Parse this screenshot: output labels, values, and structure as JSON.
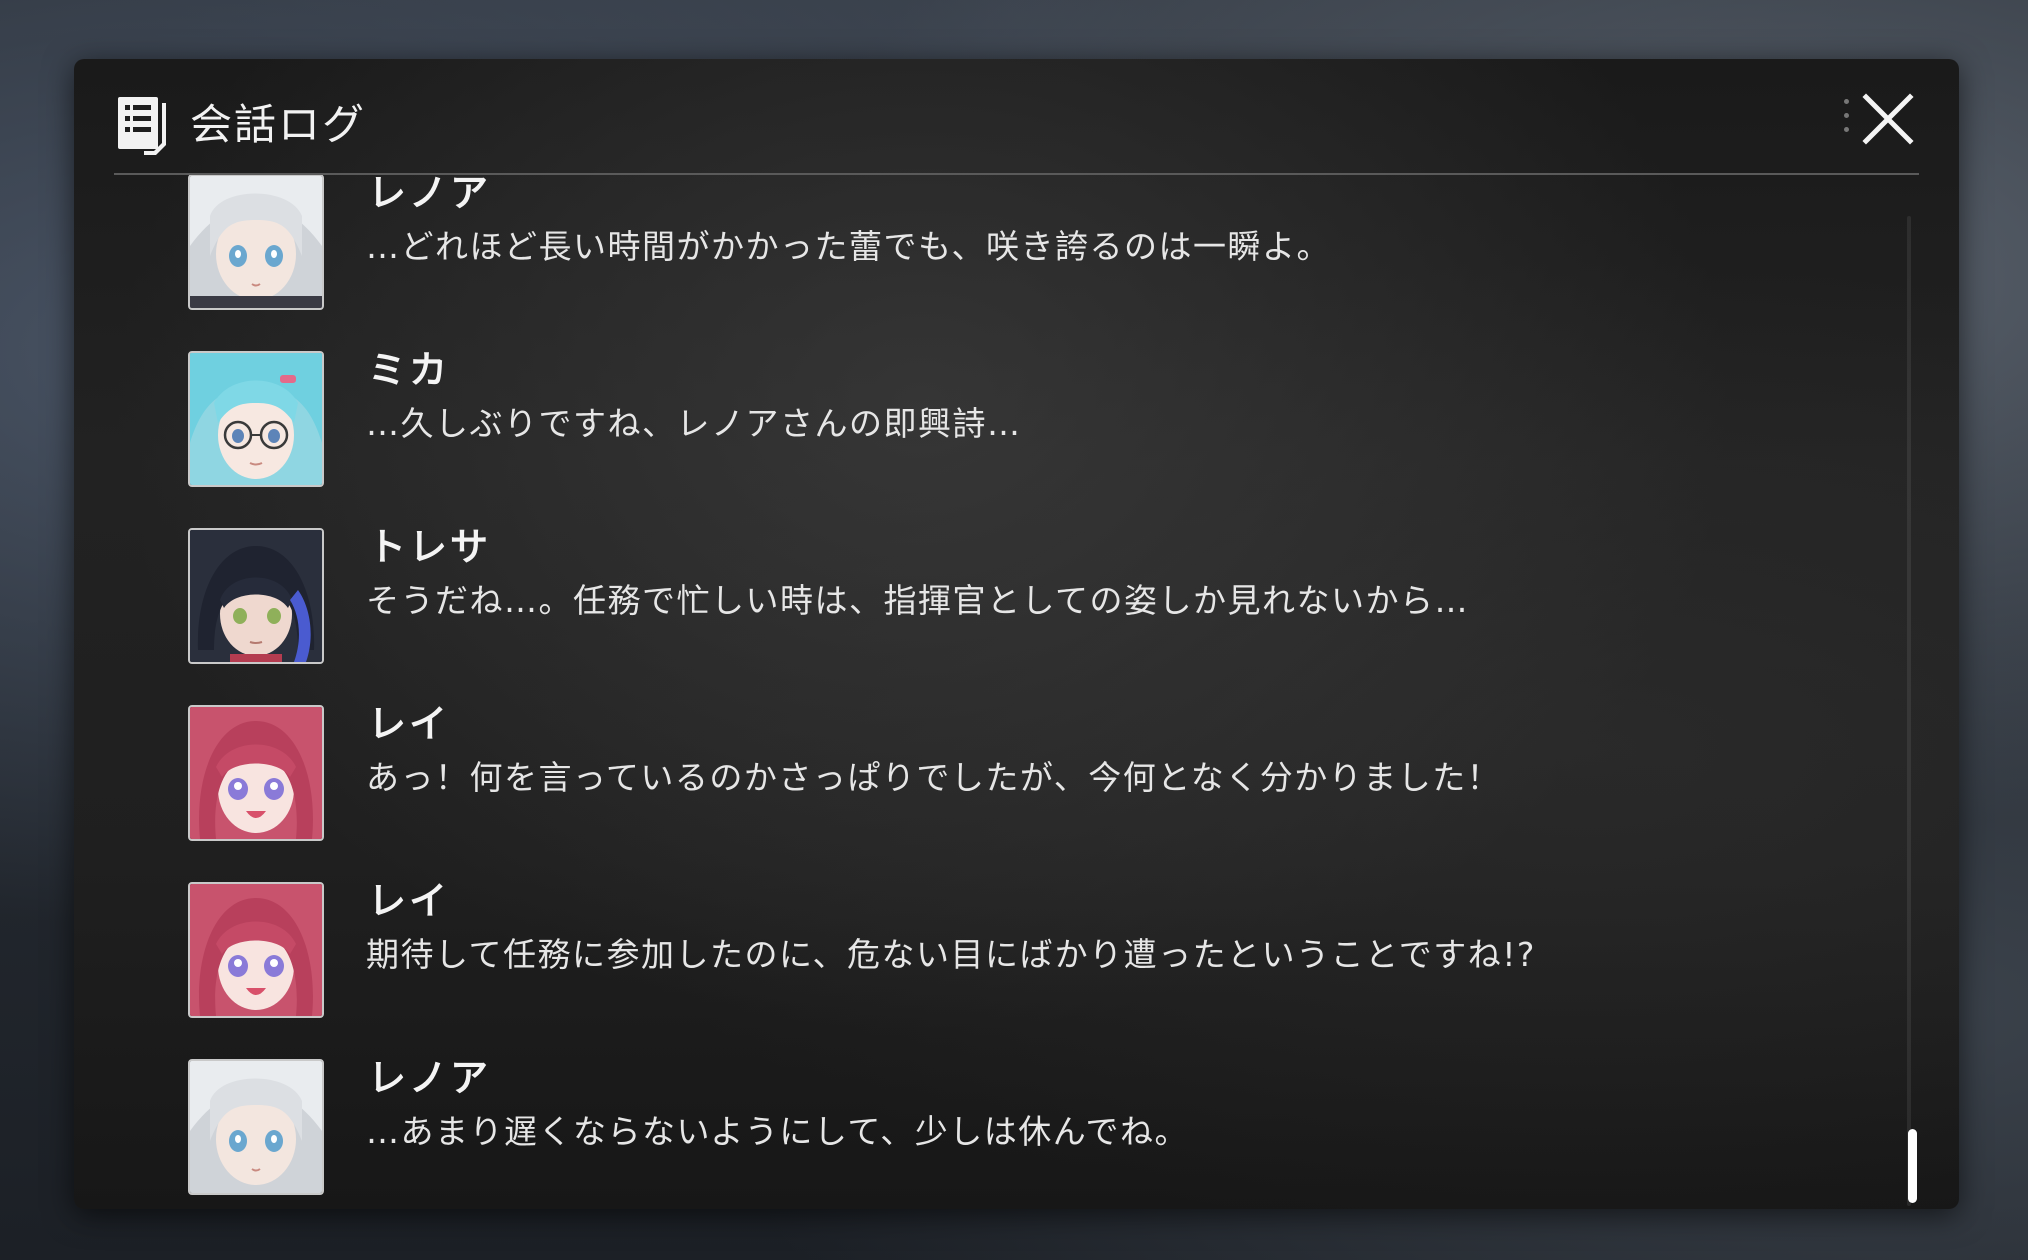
{
  "window": {
    "title": "会話ログ",
    "icon": "log-icon",
    "close_icon": "close-icon"
  },
  "colors": {
    "panel": "#1e1e1e",
    "text": "#e6e6e6",
    "divider": "#5a5a5a",
    "scroll_thumb": "#ffffff"
  },
  "log": {
    "entries": [
      {
        "speaker": "レノア",
        "text": "…どれほど長い時間がかかった蕾でも、咲き誇るのは一瞬よ。",
        "avatar": "avatar-lenore"
      },
      {
        "speaker": "ミカ",
        "text": "…久しぶりですね、レノアさんの即興詩…",
        "avatar": "avatar-mika"
      },
      {
        "speaker": "トレサ",
        "text": "そうだね…。任務で忙しい時は、指揮官としての姿しか見れないから…",
        "avatar": "avatar-tresa"
      },
      {
        "speaker": "レイ",
        "text": "あっ！何を言っているのかさっぱりでしたが、今何となく分かりました！",
        "avatar": "avatar-rei"
      },
      {
        "speaker": "レイ",
        "text": "期待して任務に参加したのに、危ない目にばかり遭ったということですね!?",
        "avatar": "avatar-rei"
      },
      {
        "speaker": "レノア",
        "text": "…あまり遅くならないようにして、少しは休んでね。",
        "avatar": "avatar-lenore"
      }
    ],
    "scroll_position": 1.0
  }
}
